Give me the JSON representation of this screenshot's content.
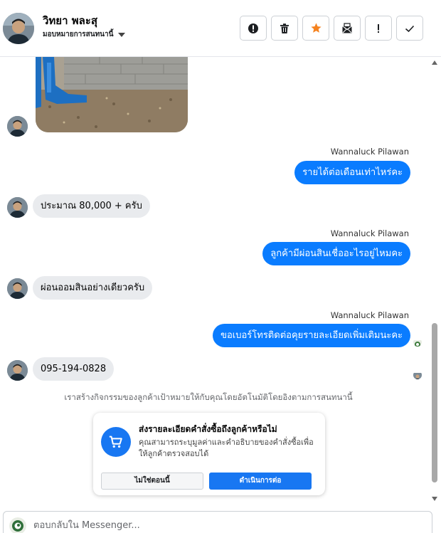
{
  "header": {
    "name": "วิทยา พละสุ",
    "assign_label": "มอบหมายการสนทนานี้",
    "actions": [
      {
        "icon": "alert-circle-icon"
      },
      {
        "icon": "trash-icon"
      },
      {
        "icon": "star-icon"
      },
      {
        "icon": "mail-icon"
      },
      {
        "icon": "exclamation-icon"
      },
      {
        "icon": "check-icon"
      }
    ]
  },
  "messages": [
    {
      "direction": "incoming",
      "type": "image"
    },
    {
      "direction": "outgoing",
      "sender": "Wannaluck Pilawan",
      "text": "รายได้ต่อเดือนเท่าไหร่คะ"
    },
    {
      "direction": "incoming",
      "text": "ประมาณ 80,000 + ครับ"
    },
    {
      "direction": "outgoing",
      "sender": "Wannaluck Pilawan",
      "text": "ลูกค้ามีผ่อนสินเชื่ออะไรอยู่ไหมคะ"
    },
    {
      "direction": "incoming",
      "text": "ผ่อนออมสินอย่างเดียวครับ"
    },
    {
      "direction": "outgoing",
      "sender": "Wannaluck Pilawan",
      "text": "ขอเบอร์โทรติดต่อคุยรายละเอียดเพิ่มเติมนะคะ"
    },
    {
      "direction": "incoming",
      "text": "095-194-0828"
    }
  ],
  "system_note": "เราสร้างกิจกรรมของลูกค้าเป้าหมายให้กับคุณโดยอัตโนมัติโดยอิงตามการสนทนานี้",
  "order_card": {
    "title": "ส่งรายละเอียดคำสั่งซื้อถึงลูกค้าหรือไม่",
    "description": "คุณสามารถระบุมูลค่าและคำอธิบายของคำสั่งซื้อเพื่อให้ลูกค้าตรวจสอบได้",
    "decline_label": "ไม่ใช่ตอนนี้",
    "confirm_label": "ดำเนินการต่อ"
  },
  "composer": {
    "placeholder": "ตอบกลับใน Messenger..."
  },
  "colors": {
    "outgoing_bubble": "#0a7cff",
    "incoming_bubble": "#e9ebee",
    "accent": "#1877f2",
    "star": "#f5821f"
  }
}
